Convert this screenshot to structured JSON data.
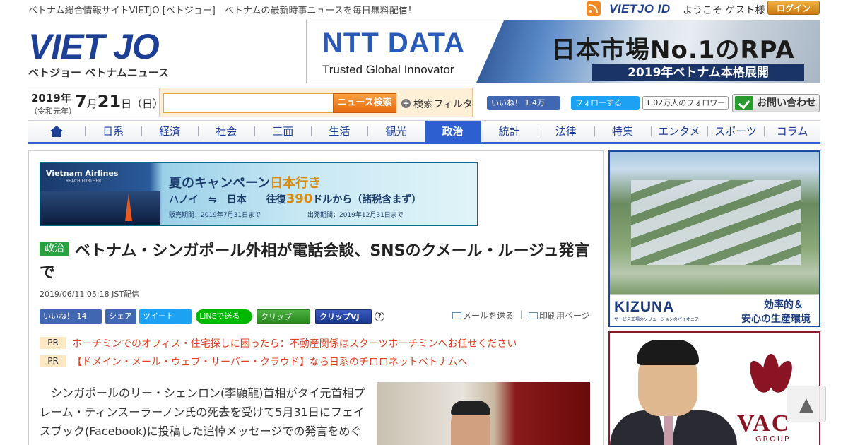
{
  "header": {
    "tagline": "ベトナム総合情報サイトVIETJO [ベトジョー]　ベトナムの最新時事ニュースを毎日無料配信！",
    "vietjo_id_logo": "VIETJO ID",
    "welcome": "ようこそ ゲスト様",
    "login_label": "ログイン",
    "logo_text_a": "VIET",
    "logo_text_b": "JO",
    "logo_sub": "ベトジョー ベトナムニュース"
  },
  "top_ad": {
    "brand": "NTT DATA",
    "slogan": "Trusted Global Innovator",
    "headline": "日本市場No.1のRPA",
    "subline": "2019年ベトナム本格展開"
  },
  "date": {
    "year": "2019年",
    "era": "（令和元年）",
    "month": "7",
    "month_unit": "月",
    "day": "21",
    "day_unit": "日",
    "weekday": "（日）"
  },
  "search": {
    "value": "",
    "button": "ニュース検索",
    "filter_label": "検索フィルタ"
  },
  "social_top": {
    "fb_like": "いいね！ 1.4万",
    "tw_follow": "フォローする",
    "tw_followers": "1.02万人のフォロワー",
    "contact": "お問い合わせ"
  },
  "nav": {
    "items": [
      "日系",
      "経済",
      "社会",
      "三面",
      "生活",
      "観光",
      "政治",
      "統計",
      "法律",
      "特集",
      "エンタメ",
      "スポーツ",
      "コラム"
    ],
    "active": "政治"
  },
  "content_ad": {
    "brand": "Vietnam Airlines",
    "reach": "REACH FURTHER",
    "title_a": "夏のキャンペーン",
    "title_b": "日本行き",
    "route_a": "ハノイ　⇋　日本　　往復",
    "price": "390",
    "route_b": "ドルから（諸税含まず）",
    "period1": "販売期間：2019年7月31日まで",
    "period2": "出発期間：2019年12月31日まで"
  },
  "article": {
    "category": "政治",
    "title": "ベトナム・シンガポール外相が電話会談、SNSのクメール・ルージュ発言で",
    "date": "2019/06/11 05:18 JST配信",
    "body": "シンガポールのリー・シェンロン(李顯龍)首相がタイ元首相プレーム・ティンスーラーノン氏の死去を受けて5月31日にフェイスブック(Facebook)に投稿した追悼メッセージでの発言をめぐっ"
  },
  "share": {
    "fb_like": "いいね！ 14",
    "fb_share": "シェア",
    "tweet": "ツイート",
    "line": "LINEで送る",
    "clip": "クリップ",
    "clip_vj": "クリップVJ",
    "help": "?",
    "email": "メールを送る",
    "separator": "|",
    "print": "印刷用ページ"
  },
  "pr": [
    {
      "tag": "PR",
      "text": "ホーチミンでのオフィス・住宅探しに困ったら：不動産関係はスターツホーチミンへお任せください"
    },
    {
      "tag": "PR",
      "text": "【ドメイン・メール・ウェブ・サーバー・クラウド】なら日系のチロロネットベトナムへ"
    }
  ],
  "sidebar": {
    "kizuna_logo": "KIZUNA",
    "kizuna_tagline": "サービス工場のソリューションのパイオニア",
    "kizuna_copy1": "効率的＆",
    "kizuna_copy2": "安心の生産環境",
    "vac_logo": "VAC",
    "vac_group": "GROUP"
  },
  "scroll_top": "▲",
  "colors": {
    "brand_blue": "#1e3f96",
    "nav_active": "#2d5fd0",
    "pr_link": "#e04020",
    "category_green": "#2aa040"
  }
}
